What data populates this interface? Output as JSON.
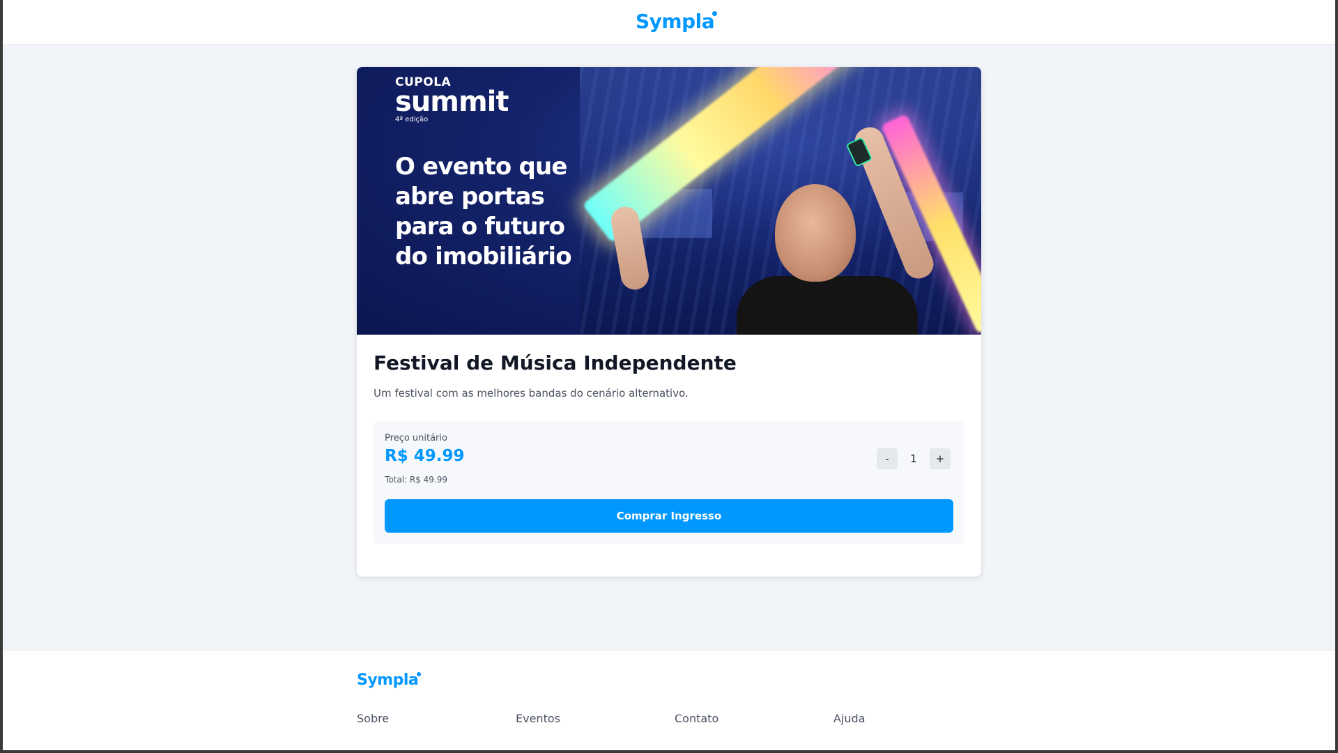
{
  "header": {
    "logo_text": "Sympla"
  },
  "banner": {
    "brand_top": "CUPOLA",
    "brand_main": "summit",
    "brand_edition": "4ª edição",
    "headline_lines": [
      "O evento que",
      "abre portas",
      "para o futuro",
      "do imobiliário"
    ]
  },
  "event": {
    "title": "Festival de Música Independente",
    "description": "Um festival com as melhores bandas do cenário alternativo."
  },
  "ticket": {
    "price_label": "Preço unitário",
    "price_value": "R$ 49.99",
    "total_label": "Total: R$ 49.99",
    "quantity": "1",
    "minus_label": "-",
    "plus_label": "+",
    "buy_label": "Comprar Ingresso"
  },
  "footer": {
    "logo_text": "Sympla",
    "links": [
      "Sobre",
      "Eventos",
      "Contato",
      "Ajuda"
    ]
  },
  "colors": {
    "brand": "#0097ff",
    "page_bg": "#f1f4f8",
    "banner_bg": "#14236b"
  }
}
